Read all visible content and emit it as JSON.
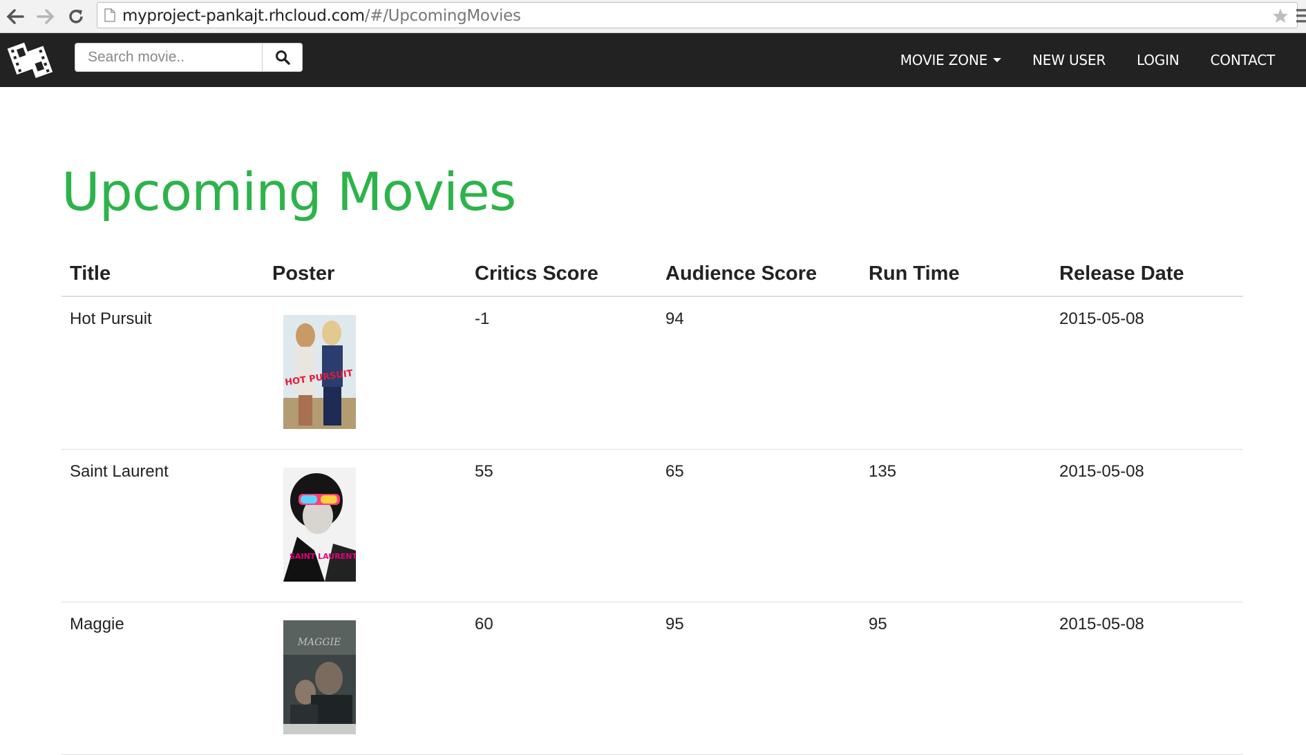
{
  "browser": {
    "url_host": "myproject-pankajt.rhcloud.com",
    "url_path": "/#/UpcomingMovies"
  },
  "navbar": {
    "search_placeholder": "Search movie..",
    "menu": [
      {
        "label": "MOVIE ZONE"
      },
      {
        "label": "NEW USER"
      },
      {
        "label": "LOGIN"
      },
      {
        "label": "CONTACT"
      }
    ]
  },
  "page": {
    "title": "Upcoming Movies"
  },
  "table": {
    "headers": [
      "Title",
      "Poster",
      "Critics Score",
      "Audience Score",
      "Run Time",
      "Release Date"
    ],
    "rows": [
      {
        "title": "Hot Pursuit",
        "critics": "-1",
        "audience": "94",
        "runtime": "",
        "release": "2015-05-08",
        "poster_text": "HOT PURSUIT"
      },
      {
        "title": "Saint Laurent",
        "critics": "55",
        "audience": "65",
        "runtime": "135",
        "release": "2015-05-08",
        "poster_text": "SAINT LAURENT"
      },
      {
        "title": "Maggie",
        "critics": "60",
        "audience": "95",
        "runtime": "95",
        "release": "2015-05-08",
        "poster_text": "MAGGIE"
      }
    ]
  },
  "colors": {
    "title_green": "#2db34a",
    "navbar_bg": "#222222"
  }
}
